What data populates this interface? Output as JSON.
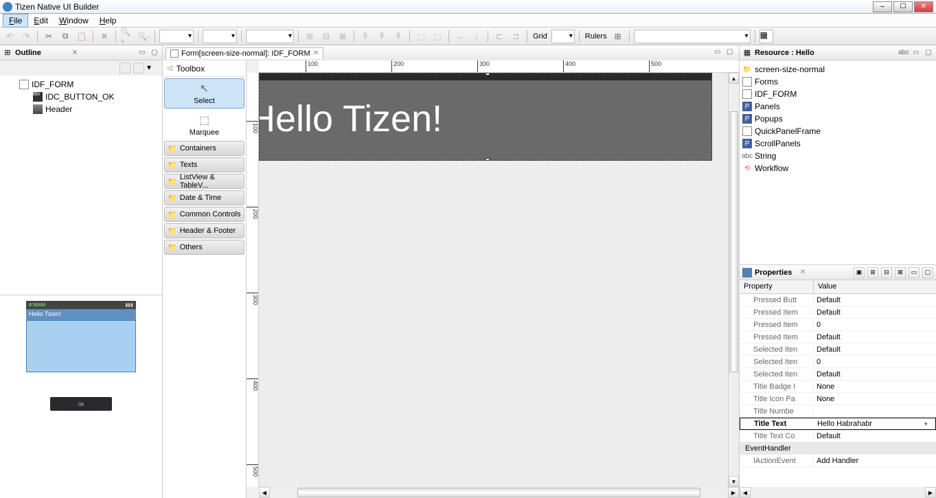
{
  "app": {
    "title": "Tizen Native UI Builder"
  },
  "window_buttons": {
    "min": "‒",
    "max": "☐",
    "close": "✕"
  },
  "menu": [
    "File",
    "Edit",
    "Window",
    "Help"
  ],
  "toolbar": {
    "grid_label": "Grid",
    "rulers_label": "Rulers"
  },
  "outline": {
    "title": "Outline",
    "items": [
      {
        "label": "IDF_FORM",
        "icon": "form"
      },
      {
        "label": "IDC_BUTTON_OK",
        "icon": "btn",
        "indent": 2
      },
      {
        "label": "Header",
        "icon": "header",
        "indent": 2
      }
    ]
  },
  "preview": {
    "time": "8:56AM",
    "header_text": "Hello Tizen!",
    "footer_btn": "ok"
  },
  "editor": {
    "tab_label": "Form[screen-size-normal]: IDF_FORM",
    "toolbox_title": "Toolbox",
    "tools": [
      {
        "label": "Select",
        "selected": true
      },
      {
        "label": "Marquee",
        "selected": false
      }
    ],
    "categories": [
      "Containers",
      "Texts",
      "ListView & TableV...",
      "Date & Time",
      "Common Controls",
      "Header & Footer",
      "Others"
    ],
    "ruler_h": [
      "100",
      "200",
      "300",
      "400",
      "500"
    ],
    "ruler_v": [
      "100",
      "200",
      "300",
      "400",
      "500"
    ],
    "form_header_text": "Hello Tizen!"
  },
  "resource": {
    "title": "Resource : Hello",
    "items": [
      {
        "label": "screen-size-normal",
        "icon": "folder",
        "indent": 1
      },
      {
        "label": "Forms",
        "icon": "doc",
        "indent": 2
      },
      {
        "label": "IDF_FORM",
        "icon": "form",
        "indent": 3
      },
      {
        "label": "Panels",
        "icon": "panel",
        "indent": 2
      },
      {
        "label": "Popups",
        "icon": "panel",
        "indent": 2
      },
      {
        "label": "QuickPanelFrame",
        "icon": "doc",
        "indent": 2
      },
      {
        "label": "ScrollPanels",
        "icon": "panel",
        "indent": 2
      },
      {
        "label": "String",
        "icon": "str",
        "indent": 1
      },
      {
        "label": "Workflow",
        "icon": "wf",
        "indent": 1
      }
    ]
  },
  "properties": {
    "title": "Properties",
    "col_property": "Property",
    "col_value": "Value",
    "rows": [
      {
        "key": "Pressed Butt",
        "val": "Default"
      },
      {
        "key": "Pressed Item",
        "val": "Default"
      },
      {
        "key": "Pressed Item",
        "val": "0"
      },
      {
        "key": "Pressed Item",
        "val": "Default"
      },
      {
        "key": "Selected Iten",
        "val": "Default"
      },
      {
        "key": "Selected Iten",
        "val": "0"
      },
      {
        "key": "Selected Iten",
        "val": "Default"
      },
      {
        "key": "Title Badge I",
        "val": "None"
      },
      {
        "key": "Title Icon Pa",
        "val": "None"
      },
      {
        "key": "Title Numbe",
        "val": ""
      },
      {
        "key": "Title Text",
        "val": "Hello Habrahabr",
        "active": true
      },
      {
        "key": "Title Text Co",
        "val": "Default"
      },
      {
        "key": "EventHandler",
        "val": "",
        "section": true
      },
      {
        "key": "IActionEvent",
        "val": "Add Handler"
      }
    ]
  }
}
